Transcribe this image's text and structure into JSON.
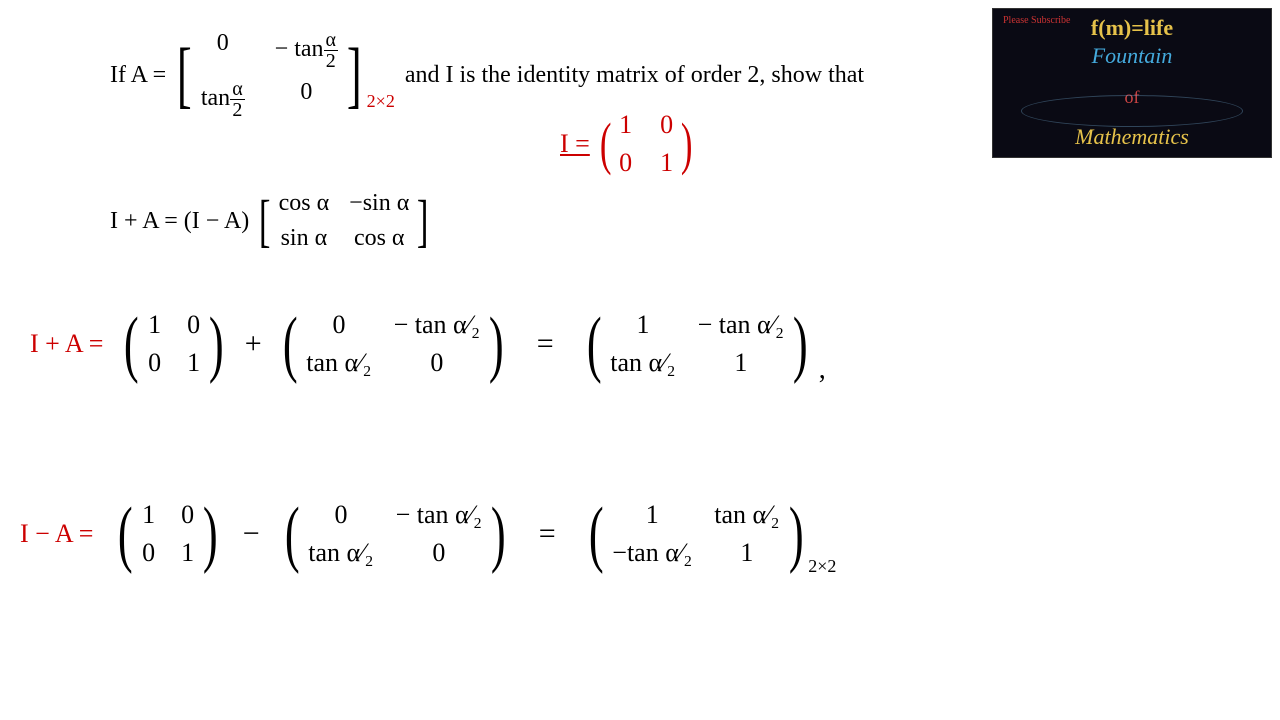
{
  "logo": {
    "subscribe": "Please Subscribe",
    "line1": "f(m)=life",
    "line2": "Fountain",
    "line3": "of",
    "line4": "Mathematics"
  },
  "problem": {
    "if": "If  A =",
    "A": {
      "r1c1": "0",
      "r1c2": "− tan",
      "r2c1": "tan",
      "r2c2": "0",
      "arg_n": "α",
      "arg_d": "2"
    },
    "mid": " and I is the identity matrix of order 2, show that",
    "sub": "2×2",
    "toshow_lhs": "I + A = (I − A)",
    "R": {
      "r1c1": "cos α",
      "r1c2": "−sin α",
      "r2c1": "sin α",
      "r2c2": "cos α"
    }
  },
  "identity": {
    "lhs": "I =",
    "m": {
      "r1c1": "1",
      "r1c2": "0",
      "r2c1": "0",
      "r2c2": "1"
    }
  },
  "line_plus": {
    "lhs": "I + A =",
    "I": {
      "r1c1": "1",
      "r1c2": "0",
      "r2c1": "0",
      "r2c2": "1"
    },
    "op": "+",
    "A": {
      "r1c1": "0",
      "r1c2": "− tan α⁄₂",
      "r2c1": "tan α⁄₂",
      "r2c2": "0"
    },
    "eq": "=",
    "res": {
      "r1c1": "1",
      "r1c2": "− tan α⁄₂",
      "r2c1": "tan α⁄₂",
      "r2c2": "1"
    },
    "tail": ","
  },
  "line_minus": {
    "lhs": "I − A =",
    "I": {
      "r1c1": "1",
      "r1c2": "0",
      "r2c1": "0",
      "r2c2": "1"
    },
    "op": "−",
    "A": {
      "r1c1": "0",
      "r1c2": "− tan α⁄₂",
      "r2c1": "tan α⁄₂",
      "r2c2": "0"
    },
    "eq": "=",
    "res": {
      "r1c1": "1",
      "r1c2": "tan α⁄₂",
      "r2c1": "−tan α⁄₂",
      "r2c2": "1"
    },
    "sub": "2×2"
  }
}
